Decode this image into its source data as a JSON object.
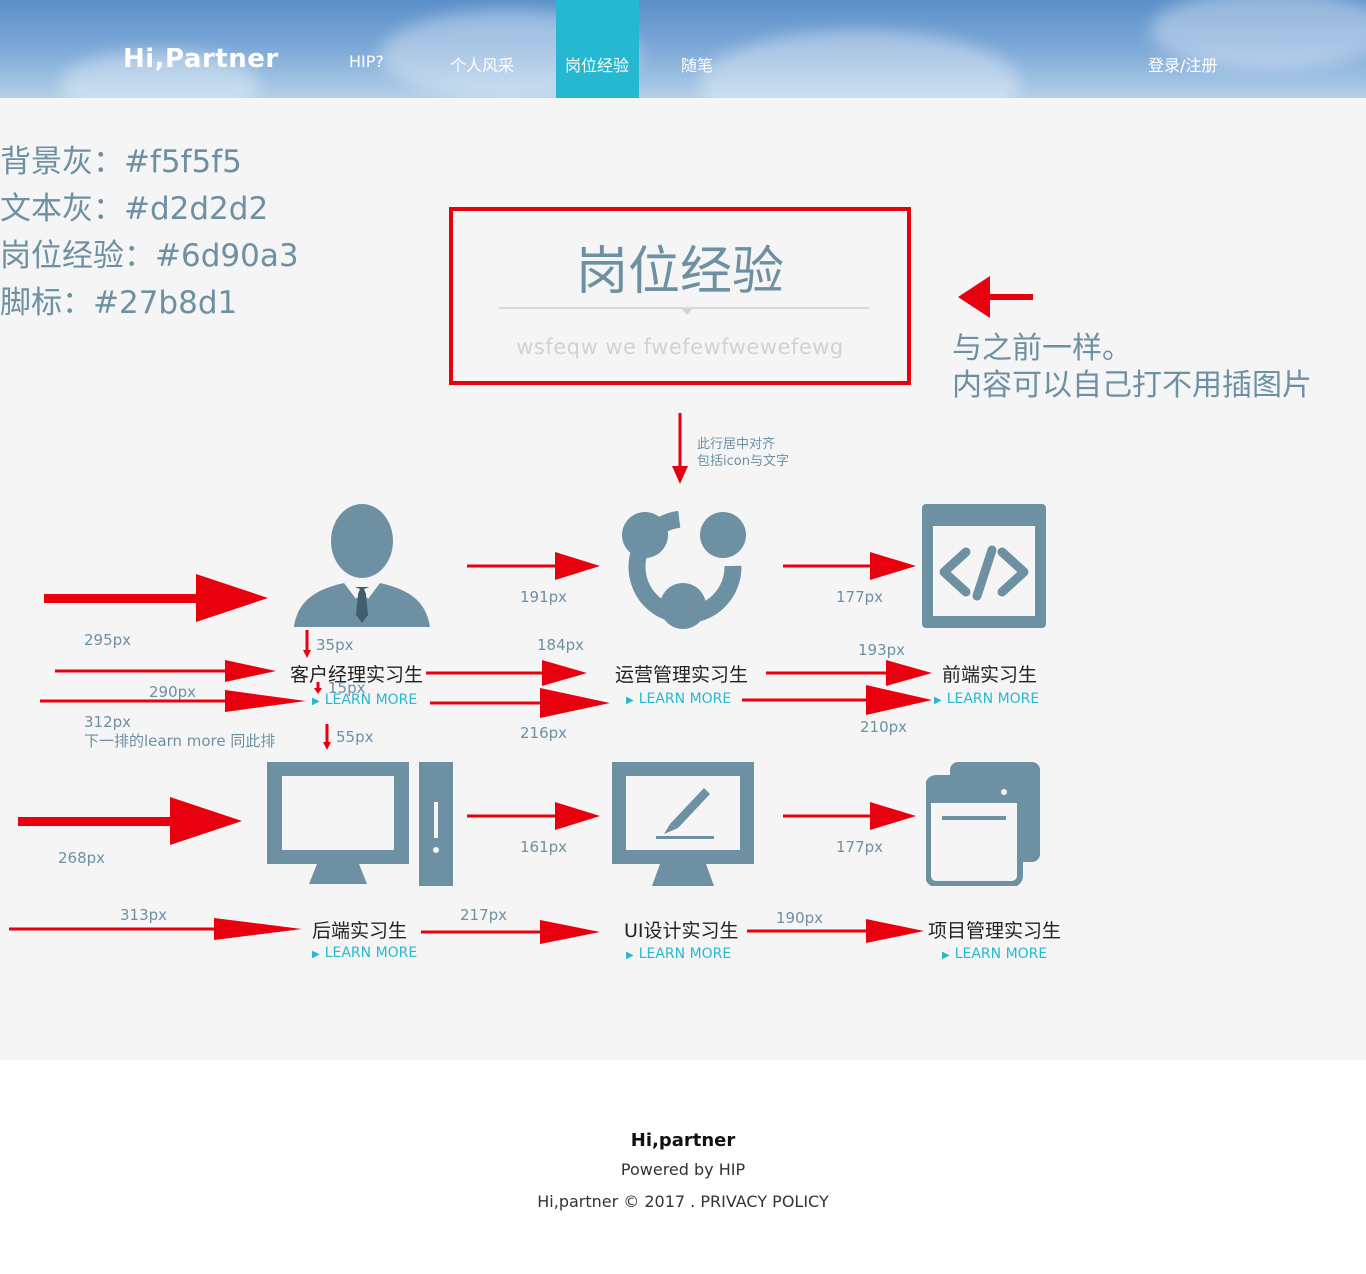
{
  "header": {
    "brand": "Hi,Partner",
    "nav": [
      "HIP?",
      "个人风采",
      "岗位经验",
      "随笔"
    ],
    "active_nav_index": 2,
    "login": "登录/注册",
    "accent_color": "#27b8d1"
  },
  "color_notes": [
    "背景灰：#f5f5f5",
    "文本灰：#d2d2d2",
    "岗位经验：#6d90a3",
    "脚标：#27b8d1"
  ],
  "section": {
    "title": "岗位经验",
    "subtitle": "wsfeqw we fwefewfwewefewg"
  },
  "side_note": [
    "与之前一样。",
    "内容可以自己打不用插图片"
  ],
  "center_note": [
    "此行居中对齐",
    "包括icon与文字"
  ],
  "learn_more": "LEARN MORE",
  "jobs": [
    {
      "title": "客户经理实习生",
      "icon": "user-icon"
    },
    {
      "title": "运营管理实习生",
      "icon": "share-icon"
    },
    {
      "title": "前端实习生",
      "icon": "code-icon"
    },
    {
      "title": "后端实习生",
      "icon": "desktop-icon"
    },
    {
      "title": "UI设计实习生",
      "icon": "design-icon"
    },
    {
      "title": "项目管理实习生",
      "icon": "window-icon"
    }
  ],
  "measurements": {
    "m295": "295px",
    "m191": "191px",
    "m177a": "177px",
    "m35": "35px",
    "m184": "184px",
    "m193": "193px",
    "m15": "15px",
    "m290": "290px",
    "m312": "312px",
    "m312_note": "下一排的learn more 同此排",
    "m55": "55px",
    "m216": "216px",
    "m210": "210px",
    "m268": "268px",
    "m161": "161px",
    "m177b": "177px",
    "m313": "313px",
    "m217": "217px",
    "m190": "190px"
  },
  "footer": {
    "brand": "Hi,partner",
    "powered": "Powered by HIP",
    "copyright": "Hi,partner © 2017 . PRIVACY POLICY"
  }
}
